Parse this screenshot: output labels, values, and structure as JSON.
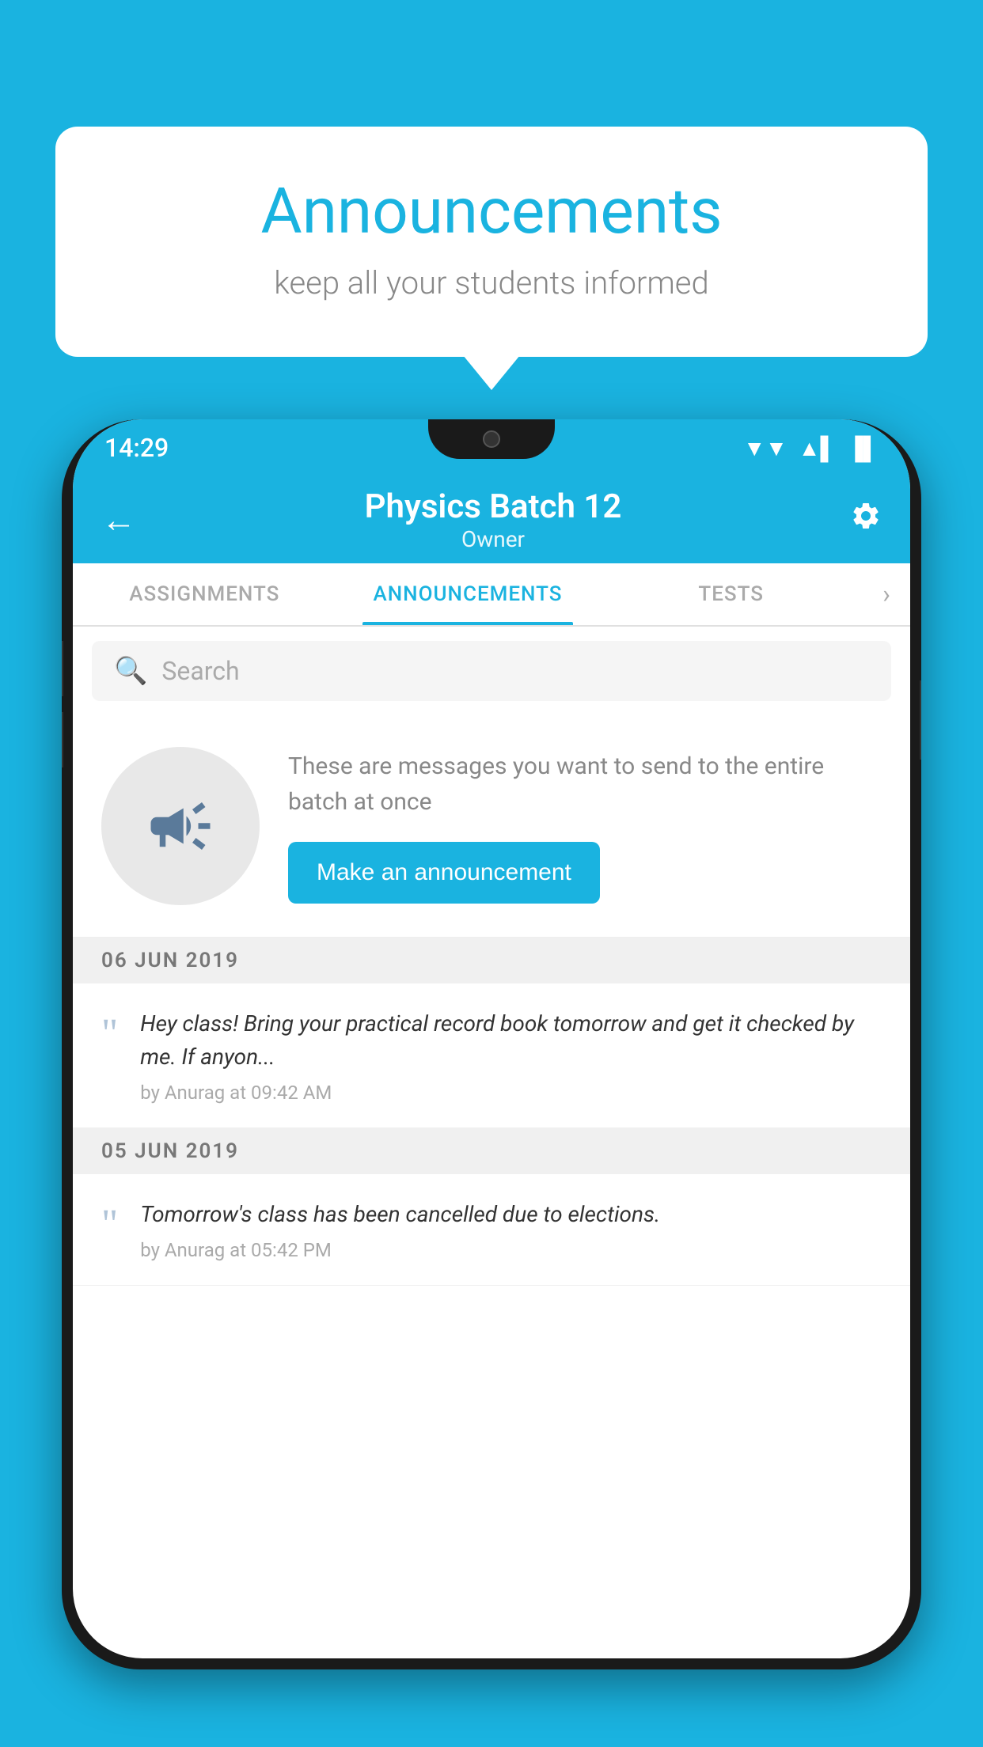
{
  "bubble": {
    "title": "Announcements",
    "subtitle": "keep all your students informed"
  },
  "status_bar": {
    "time": "14:29",
    "wifi": "▲",
    "signal": "▲",
    "battery": "▮"
  },
  "app_bar": {
    "title": "Physics Batch 12",
    "subtitle": "Owner",
    "back_label": "←",
    "settings_label": "⚙"
  },
  "tabs": [
    {
      "label": "ASSIGNMENTS",
      "active": false
    },
    {
      "label": "ANNOUNCEMENTS",
      "active": true
    },
    {
      "label": "TESTS",
      "active": false
    }
  ],
  "search": {
    "placeholder": "Search"
  },
  "promo": {
    "description": "These are messages you want to send to the entire batch at once",
    "button_label": "Make an announcement"
  },
  "announcements": [
    {
      "date": "06  JUN  2019",
      "message": "Hey class! Bring your practical record book tomorrow and get it checked by me. If anyon...",
      "meta": "by Anurag at 09:42 AM"
    },
    {
      "date": "05  JUN  2019",
      "message": "Tomorrow's class has been cancelled due to elections.",
      "meta": "by Anurag at 05:42 PM"
    }
  ]
}
